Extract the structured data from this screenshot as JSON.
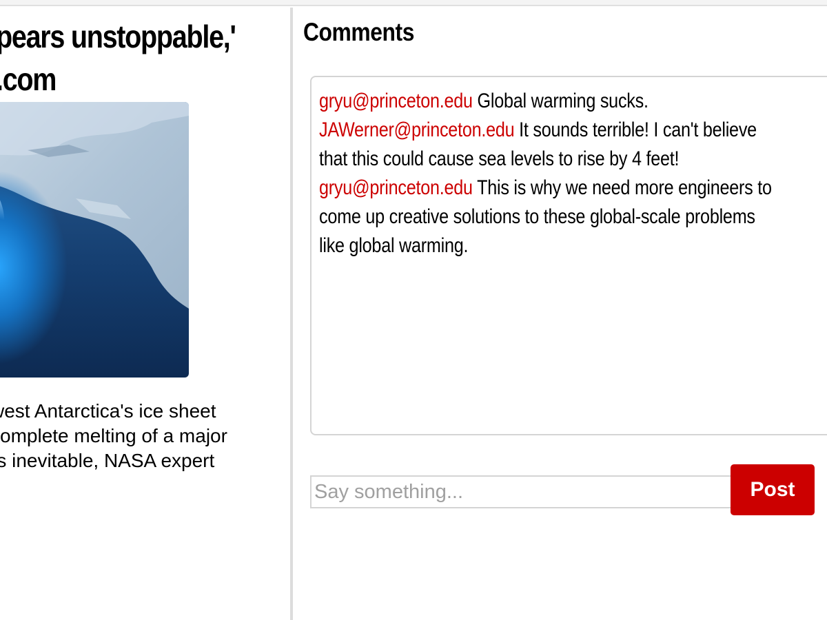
{
  "article": {
    "title_lines": [
      "pears unstoppable,'",
      ".com"
    ],
    "image_alt": "antarctic-ice-shelf",
    "body_lines": [
      "west Antarctica's ice sheet",
      "complete melting of a major",
      "rs inevitable, NASA expert"
    ]
  },
  "comments": {
    "heading": "Comments",
    "author_color": "#cc0000",
    "lines": [
      {
        "author": "gryu@princeton.edu",
        "text": "Global warming sucks."
      },
      {
        "author": "JAWerner@princeton.edu",
        "text": "It sounds terrible! I can't believe"
      },
      {
        "author": "",
        "text": "that this could cause sea levels to rise by 4 feet!"
      },
      {
        "author": "gryu@princeton.edu",
        "text": "This is why we need more engineers to"
      },
      {
        "author": "",
        "text": "come up creative solutions to these global-scale problems"
      },
      {
        "author": "",
        "text": "like global warming."
      }
    ],
    "input": {
      "placeholder": "Say something...",
      "value": ""
    },
    "post_label": "Post"
  }
}
